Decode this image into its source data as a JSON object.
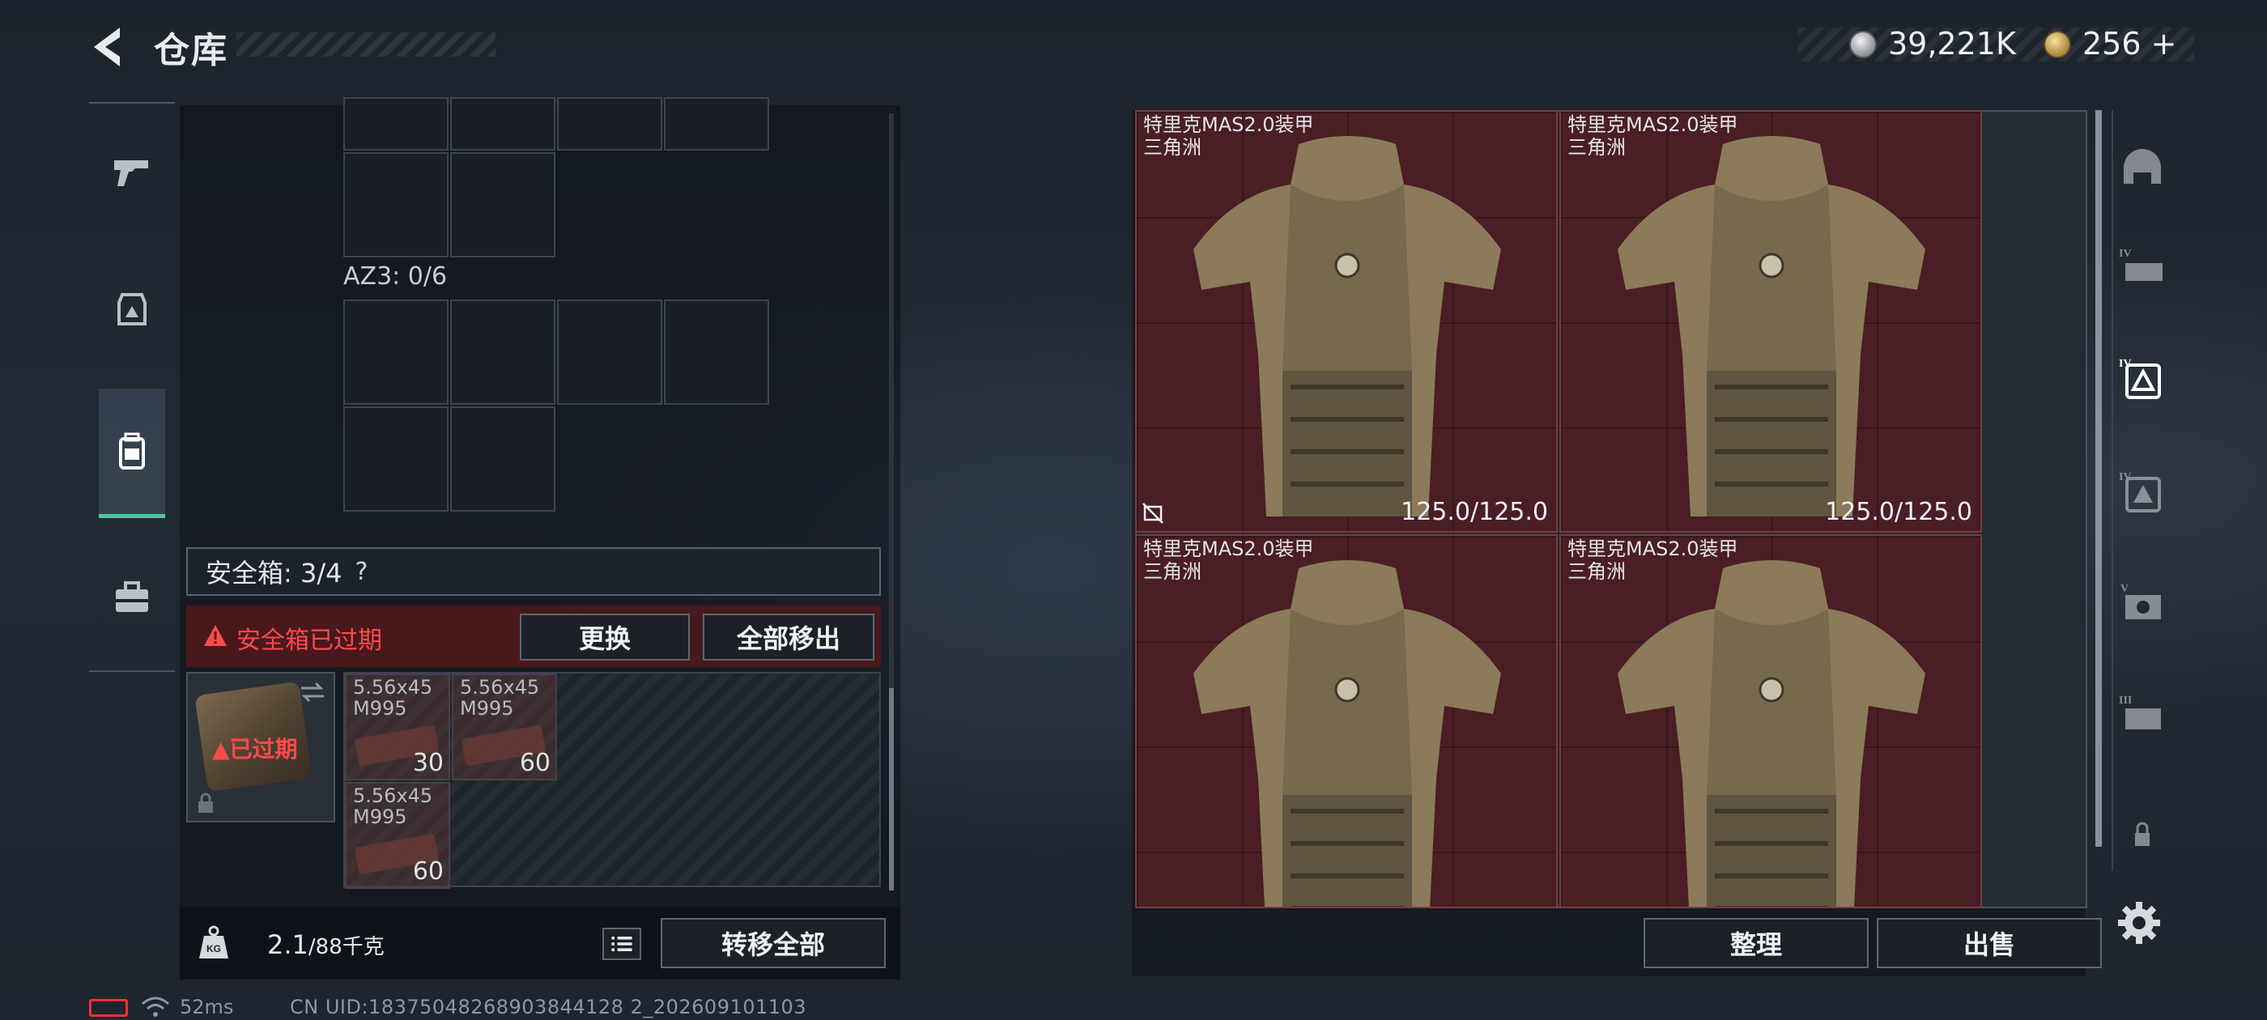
{
  "header": {
    "title": "仓库",
    "currency": {
      "silver": "39,221K",
      "gold": "256 +"
    }
  },
  "left_tabs": [
    {
      "name": "weapons",
      "icon": "pistol-icon",
      "active": false
    },
    {
      "name": "equipment",
      "icon": "helmet-bag-icon",
      "active": false
    },
    {
      "name": "containers",
      "icon": "backpack-icon",
      "active": true
    },
    {
      "name": "supplies",
      "icon": "toolbox-icon",
      "active": false
    }
  ],
  "loadout": {
    "az3_label": "AZ3: 0/6",
    "safebox": {
      "header": "安全箱: 3/4",
      "help": "?",
      "expired_notice": "安全箱已过期",
      "item_status": "已过期",
      "replace_button": "更换",
      "move_all_button": "全部移出"
    },
    "ammo": [
      {
        "name_line1": "5.56x45",
        "name_line2": "M995",
        "count": "30"
      },
      {
        "name_line1": "5.56x45",
        "name_line2": "M995",
        "count": "60"
      },
      {
        "name_line1": "5.56x45",
        "name_line2": "M995",
        "count": "60"
      }
    ],
    "weight": {
      "current": "2.1",
      "max": "/88千克"
    },
    "transfer_all_button": "转移全部"
  },
  "stash": {
    "items": [
      {
        "name": "特里克MAS2.0装甲",
        "origin": "三角洲",
        "durability": "125.0/125.0",
        "no_trade": true
      },
      {
        "name": "特里克MAS2.0装甲",
        "origin": "三角洲",
        "durability": "125.0/125.0",
        "no_trade": false
      },
      {
        "name": "特里克MAS2.0装甲",
        "origin": "三角洲",
        "durability": "",
        "no_trade": false
      },
      {
        "name": "特里克MAS2.0装甲",
        "origin": "三角洲",
        "durability": "",
        "no_trade": false
      }
    ],
    "sort_button": "整理",
    "sell_button": "出售"
  },
  "right_categories": [
    {
      "icon": "helmet-icon",
      "active": false
    },
    {
      "icon": "tier-iv-rig-icon",
      "active": false
    },
    {
      "icon": "tier-iv-armor-icon",
      "active": true
    },
    {
      "icon": "tier-iv-armor-alt-icon",
      "active": false
    },
    {
      "icon": "tier-v-armor-icon",
      "active": false
    },
    {
      "icon": "tier-iii-rig-icon",
      "active": false
    },
    {
      "icon": "lock-icon",
      "active": false
    }
  ],
  "status_bar": {
    "ping": "52ms",
    "uid": "CN UID:18375048268903844128 2_202609101103"
  },
  "colors": {
    "accent_green": "#4fc3a1",
    "warning_red": "#ff4a4a",
    "item_bg": "#4a1e24"
  }
}
